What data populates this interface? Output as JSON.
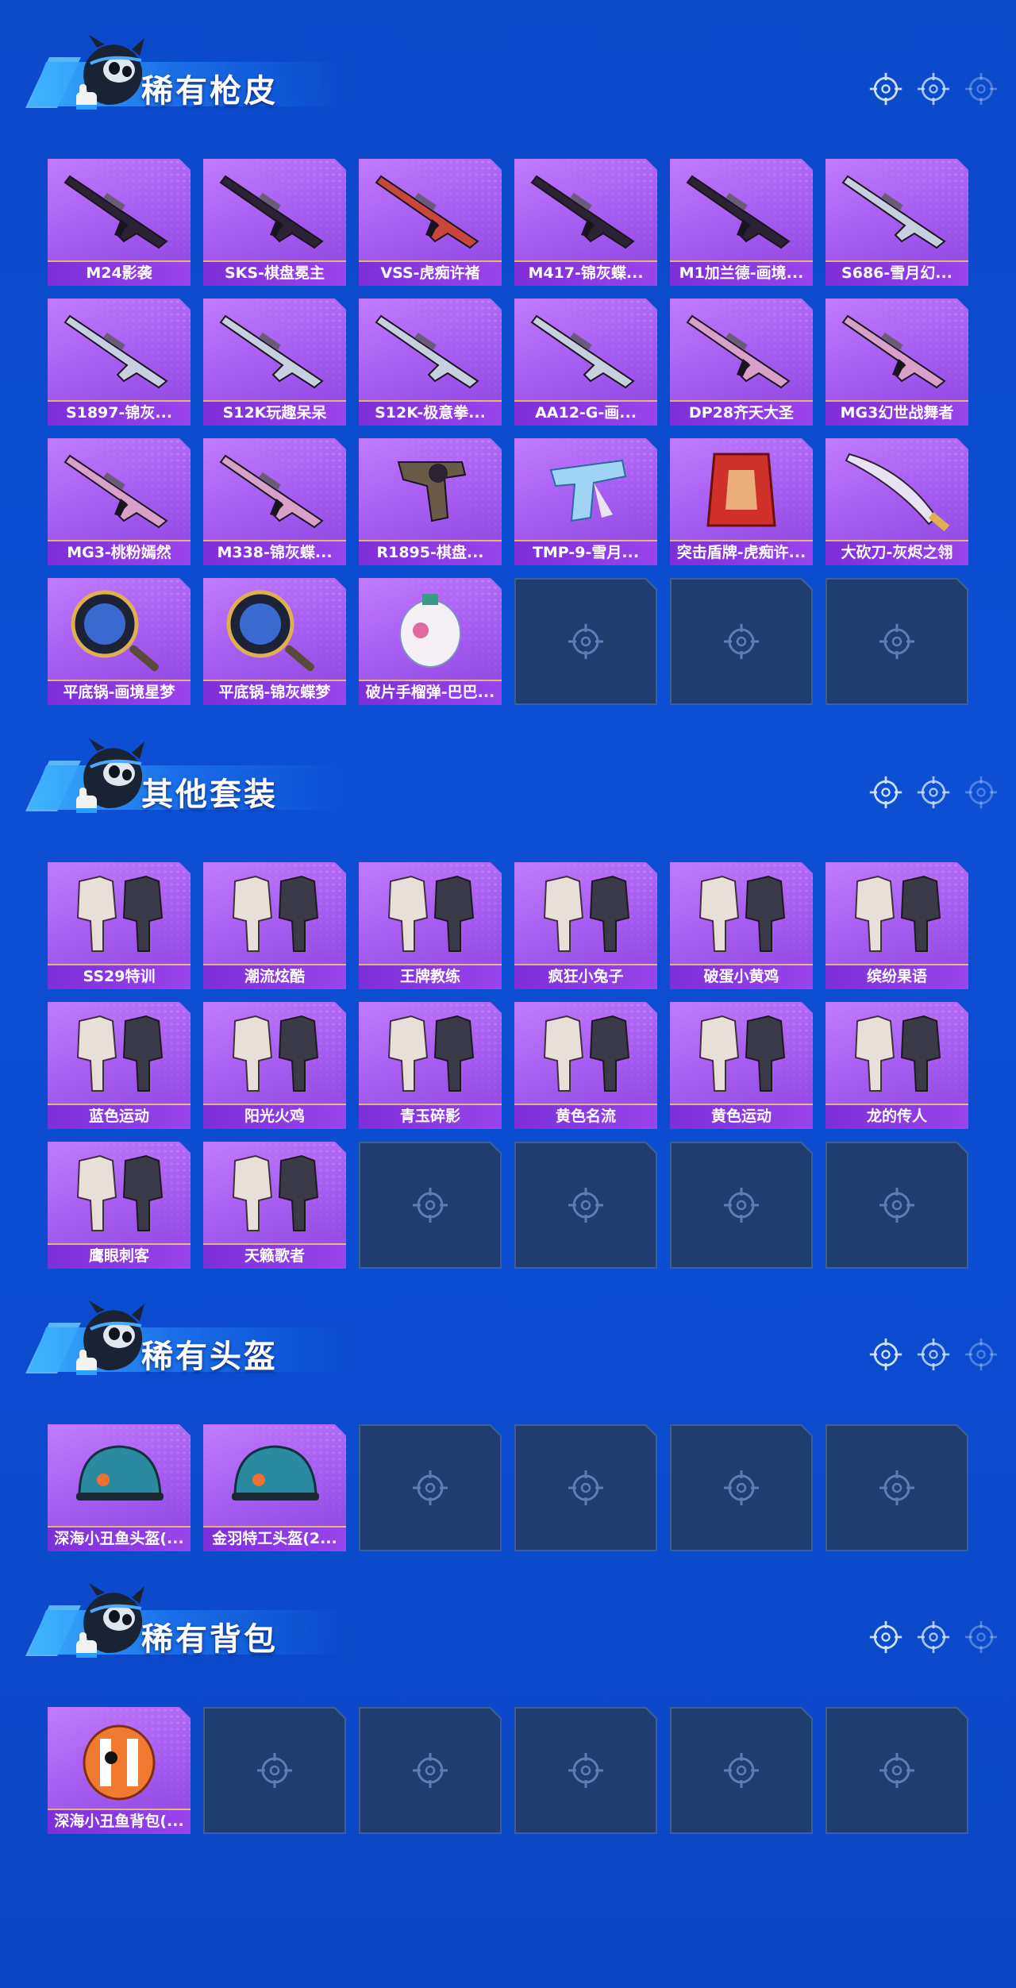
{
  "colors": {
    "background": "#0d4ed3",
    "card_purple": "#a85ff2",
    "label_bar": "#7d2fd8",
    "empty_slot": "#1f3d6e",
    "title_text": "#ffffff"
  },
  "sections": [
    {
      "title": "稀有枪皮",
      "items": [
        {
          "label": "M24影袭",
          "icon": "sniper-rifle-icon"
        },
        {
          "label": "SKS-棋盘冕主",
          "icon": "rifle-icon"
        },
        {
          "label": "VSS-虎痴许褚",
          "icon": "scoped-rifle-icon"
        },
        {
          "label": "M417-锦灰蝶...",
          "icon": "assault-rifle-icon"
        },
        {
          "label": "M1加兰德-画境...",
          "icon": "rifle-icon"
        },
        {
          "label": "S686-雪月幻...",
          "icon": "shotgun-icon"
        },
        {
          "label": "S1897-锦灰...",
          "icon": "shotgun-icon"
        },
        {
          "label": "S12K玩趣呆呆",
          "icon": "shotgun-icon"
        },
        {
          "label": "S12K-极意拳...",
          "icon": "shotgun-icon"
        },
        {
          "label": "AA12-G-画...",
          "icon": "shotgun-icon"
        },
        {
          "label": "DP28齐天大圣",
          "icon": "machine-gun-icon"
        },
        {
          "label": "MG3幻世战舞者",
          "icon": "machine-gun-icon"
        },
        {
          "label": "MG3-桃粉嫣然",
          "icon": "machine-gun-icon"
        },
        {
          "label": "M338-锦灰蝶...",
          "icon": "machine-gun-icon"
        },
        {
          "label": "R1895-棋盘...",
          "icon": "revolver-icon"
        },
        {
          "label": "TMP-9-雪月...",
          "icon": "pistol-icon"
        },
        {
          "label": "突击盾牌-虎痴许...",
          "icon": "shield-icon"
        },
        {
          "label": "大砍刀-灰烬之翎",
          "icon": "machete-icon"
        },
        {
          "label": "平底锅-画境星梦",
          "icon": "frying-pan-icon"
        },
        {
          "label": "平底锅-锦灰蝶梦",
          "icon": "frying-pan-icon"
        },
        {
          "label": "破片手榴弹-巴巴...",
          "icon": "grenade-icon"
        }
      ],
      "empty_slots": 3
    },
    {
      "title": "其他套装",
      "items": [
        {
          "label": "SS29特训",
          "icon": "outfit-icon"
        },
        {
          "label": "潮流炫酷",
          "icon": "outfit-icon"
        },
        {
          "label": "王牌教练",
          "icon": "outfit-icon"
        },
        {
          "label": "疯狂小兔子",
          "icon": "outfit-icon"
        },
        {
          "label": "破蛋小黄鸡",
          "icon": "outfit-icon"
        },
        {
          "label": "缤纷果语",
          "icon": "outfit-icon"
        },
        {
          "label": "蓝色运动",
          "icon": "outfit-icon"
        },
        {
          "label": "阳光火鸡",
          "icon": "outfit-icon"
        },
        {
          "label": "青玉碎影",
          "icon": "outfit-icon"
        },
        {
          "label": "黄色名流",
          "icon": "outfit-icon"
        },
        {
          "label": "黄色运动",
          "icon": "outfit-icon"
        },
        {
          "label": "龙的传人",
          "icon": "outfit-icon"
        },
        {
          "label": "鹰眼刺客",
          "icon": "outfit-icon"
        },
        {
          "label": "天籁歌者",
          "icon": "outfit-icon"
        }
      ],
      "empty_slots": 4
    },
    {
      "title": "稀有头盔",
      "items": [
        {
          "label": "深海小丑鱼头盔(...",
          "icon": "helmet-icon"
        },
        {
          "label": "金羽特工头盔(2...",
          "icon": "helmet-icon"
        }
      ],
      "empty_slots": 4
    },
    {
      "title": "稀有背包",
      "items": [
        {
          "label": "深海小丑鱼背包(...",
          "icon": "backpack-icon"
        }
      ],
      "empty_slots": 5
    }
  ]
}
